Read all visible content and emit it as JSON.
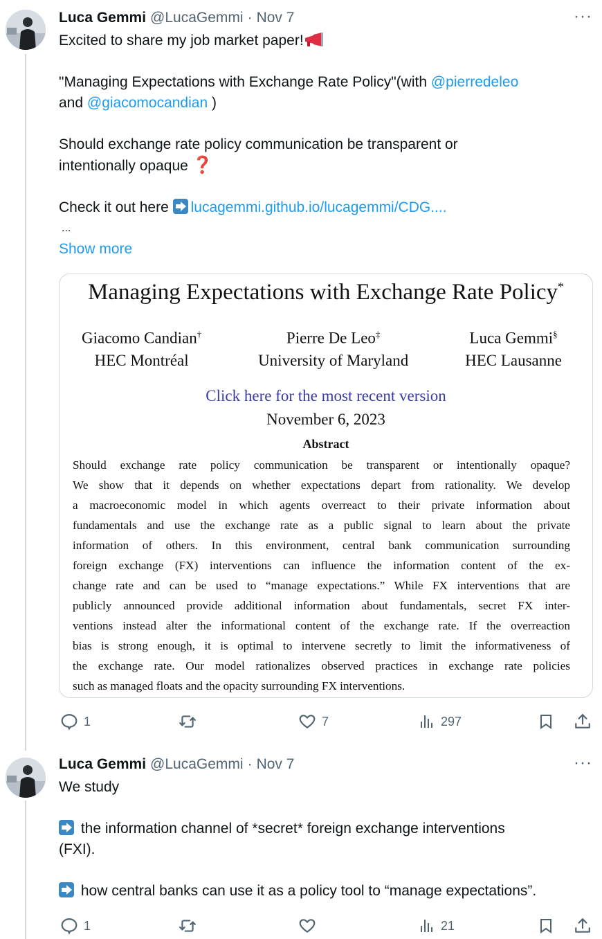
{
  "tweets": [
    {
      "author": "Luca Gemmi",
      "handle": "@LucaGemmi",
      "separator": "·",
      "time": "Nov 7",
      "more": "···",
      "text": {
        "l1": "Excited to share my job market paper!",
        "l3a": "\"Managing Expectations with Exchange Rate Policy\"(with ",
        "m1": "@pierredeleo",
        "l4a": "and ",
        "m2": "@giacomocandian",
        "l4b": " )",
        "l6": "Should exchange rate policy communication be transparent or",
        "l7": "intentionally opaque",
        "l7q": "❓",
        "l9a": "Check it out here ",
        "link": "lucagemmi.github.io/lucagemmi/CDG....",
        "ellipsis": "...",
        "show_more": "Show more"
      },
      "paper": {
        "title": "Managing Expectations with Exchange Rate Policy",
        "title_mark": "*",
        "authors": [
          {
            "name": "Giacomo Candian",
            "mark": "†",
            "affiliation": "HEC Montréal"
          },
          {
            "name": "Pierre De Leo",
            "mark": "‡",
            "affiliation": "University of Maryland"
          },
          {
            "name": "Luca Gemmi",
            "mark": "§",
            "affiliation": "HEC Lausanne"
          }
        ],
        "link": "Click here for the most recent version",
        "date": "November 6, 2023",
        "abstract_heading": "Abstract",
        "abstract_lines": [
          "Should exchange rate policy communication be transparent or intentionally opaque?",
          "We show that it depends on whether expectations depart from rationality. We develop",
          "a macroeconomic model in which agents overreact to their private information about",
          "fundamentals and use the exchange rate as a public signal to learn about the private",
          "information of others. In this environment, central bank communication surrounding",
          "foreign exchange (FX) interventions can influence the information content of the ex-",
          "change rate and can be used to “manage expectations.” While FX interventions that are",
          "publicly announced provide additional information about fundamentals, secret FX inter-",
          "ventions instead alter the informational content of the exchange rate. If the overreaction",
          "bias is strong enough, it is optimal to intervene secretly to limit the informativeness of",
          "the exchange rate. Our model rationalizes observed practices in exchange rate policies",
          "such as managed floats and the opacity surrounding FX interventions."
        ]
      },
      "stats": {
        "replies": "1",
        "reposts": "",
        "likes": "7",
        "views": "297"
      }
    },
    {
      "author": "Luca Gemmi",
      "handle": "@LucaGemmi",
      "separator": "·",
      "time": "Nov 7",
      "more": "···",
      "text": {
        "l1": "We study",
        "l3": "the information channel of *secret* foreign exchange interventions",
        "l4": "(FXI).",
        "l6": "how central banks can use it as a policy tool to “manage expectations”."
      },
      "stats": {
        "replies": "1",
        "reposts": "",
        "likes": "",
        "views": "21"
      }
    }
  ],
  "icons": [
    "reply-icon",
    "repost-icon",
    "like-icon",
    "views-icon",
    "bookmark-icon",
    "share-icon",
    "arrow-right-emoji",
    "megaphone-emoji",
    "question-emoji"
  ],
  "colors": {
    "link": "#1d9bf0",
    "muted": "#536471",
    "border": "#cfd9de",
    "paper_link": "#3b3ba5"
  }
}
